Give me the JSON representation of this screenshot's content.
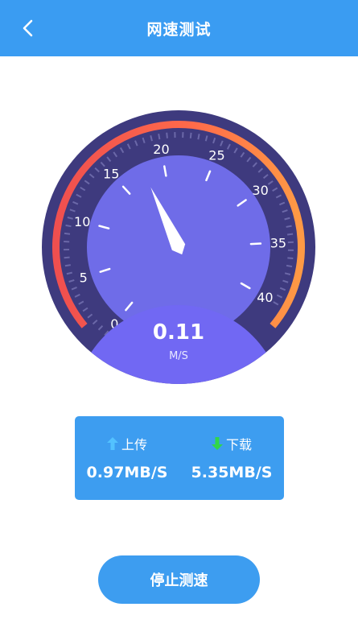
{
  "header": {
    "title": "网速测试"
  },
  "gauge": {
    "scale_labels": [
      "0",
      "5",
      "10",
      "15",
      "20",
      "25",
      "30",
      "35",
      "40"
    ],
    "value": "0.11",
    "unit": "M/S"
  },
  "stats": {
    "upload_label": "上传",
    "upload_value": "0.97MB/S",
    "download_label": "下载",
    "download_value": "5.35MB/S"
  },
  "actions": {
    "stop_label": "停止测速"
  },
  "colors": {
    "header": "#3a9cf2",
    "gauge_bg": "#3e3a7e",
    "dial": "#6f6ce8",
    "arc_start": "#ef4f4f",
    "arc_end": "#ff9a45",
    "upload_arrow": "#53c2ff",
    "download_arrow": "#31d64a"
  }
}
